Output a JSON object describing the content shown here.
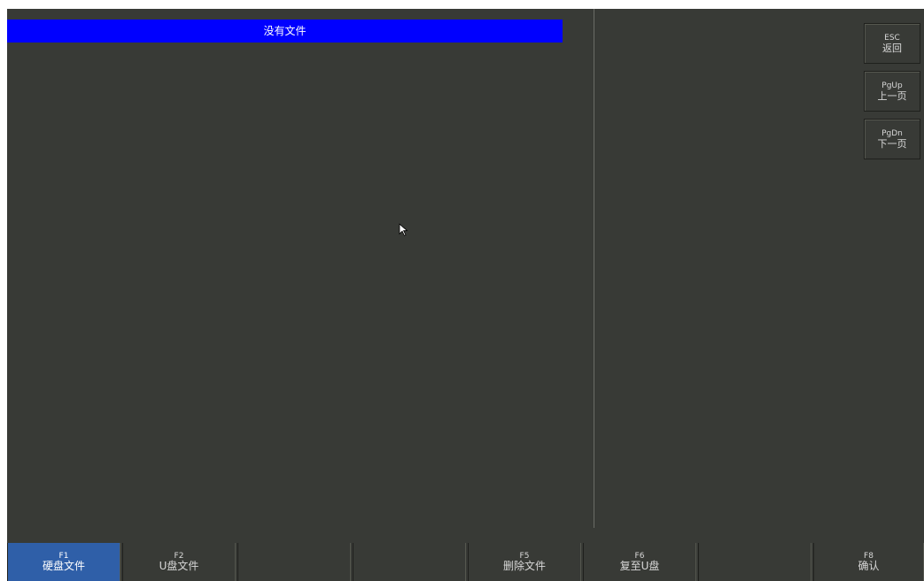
{
  "banner": {
    "text": "没有文件"
  },
  "side_buttons": [
    {
      "key": "ESC",
      "label": "返回"
    },
    {
      "key": "PgUp",
      "label": "上一页"
    },
    {
      "key": "PgDn",
      "label": "下一页"
    }
  ],
  "function_keys": [
    {
      "key": "F1",
      "label": "硬盘文件",
      "active": true
    },
    {
      "key": "F2",
      "label": "U盘文件",
      "active": false
    },
    {
      "key": "",
      "label": "",
      "active": false
    },
    {
      "key": "",
      "label": "",
      "active": false
    },
    {
      "key": "F5",
      "label": "删除文件",
      "active": false
    },
    {
      "key": "F6",
      "label": "复至U盘",
      "active": false
    },
    {
      "key": "",
      "label": "",
      "active": false
    },
    {
      "key": "F8",
      "label": "确认",
      "active": false
    }
  ],
  "colors": {
    "background": "#383a36",
    "banner": "#0000ff",
    "active_key": "#2f5fa8",
    "text": "#d8d8d8"
  },
  "icons": {
    "cursor": "mouse-pointer-icon"
  }
}
